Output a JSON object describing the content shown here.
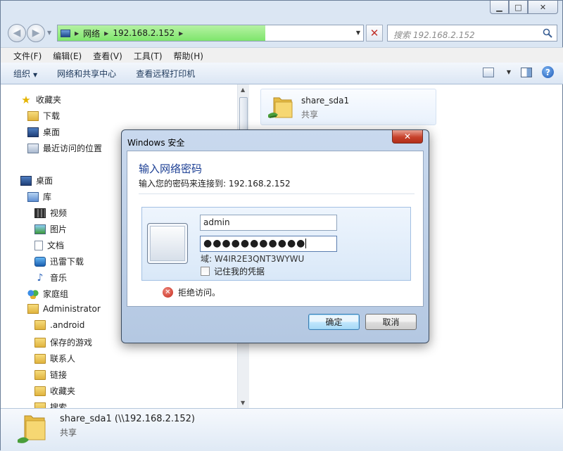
{
  "explorer": {
    "address": {
      "segments": [
        "网络",
        "192.168.2.152"
      ]
    },
    "search": {
      "placeholder": "搜索 192.168.2.152"
    },
    "menu": [
      "文件(F)",
      "编辑(E)",
      "查看(V)",
      "工具(T)",
      "帮助(H)"
    ],
    "toolbar": {
      "organize": "组织",
      "network_center": "网络和共享中心",
      "printers": "查看远程打印机"
    },
    "nav": {
      "favorites": "收藏夹",
      "downloads": "下载",
      "desktop_fav": "桌面",
      "recent": "最近访问的位置",
      "desktop": "桌面",
      "libraries": "库",
      "videos": "视频",
      "pictures": "图片",
      "documents": "文档",
      "thunder": "迅雷下载",
      "music": "音乐",
      "homegroup": "家庭组",
      "admin": "Administrator",
      "android": ".android",
      "saved_games": "保存的游戏",
      "contacts": "联系人",
      "links": "链接",
      "favorites2": "收藏夹",
      "searches": "搜索"
    },
    "share": {
      "name": "share_sda1",
      "type": "共享"
    },
    "details": {
      "name": "share_sda1 (\\\\192.168.2.152)",
      "type": "共享"
    }
  },
  "dialog": {
    "title": "Windows 安全",
    "heading": "输入网络密码",
    "subtitle": "输入您的密码来连接到: 192.168.2.152",
    "username": "admin",
    "password_mask": "●●●●●●●●●●●",
    "domain": "域: W4IR2E3QNT3WYWU",
    "remember": "记住我的凭据",
    "error": "拒绝访问。",
    "ok": "确定",
    "cancel": "取消"
  }
}
